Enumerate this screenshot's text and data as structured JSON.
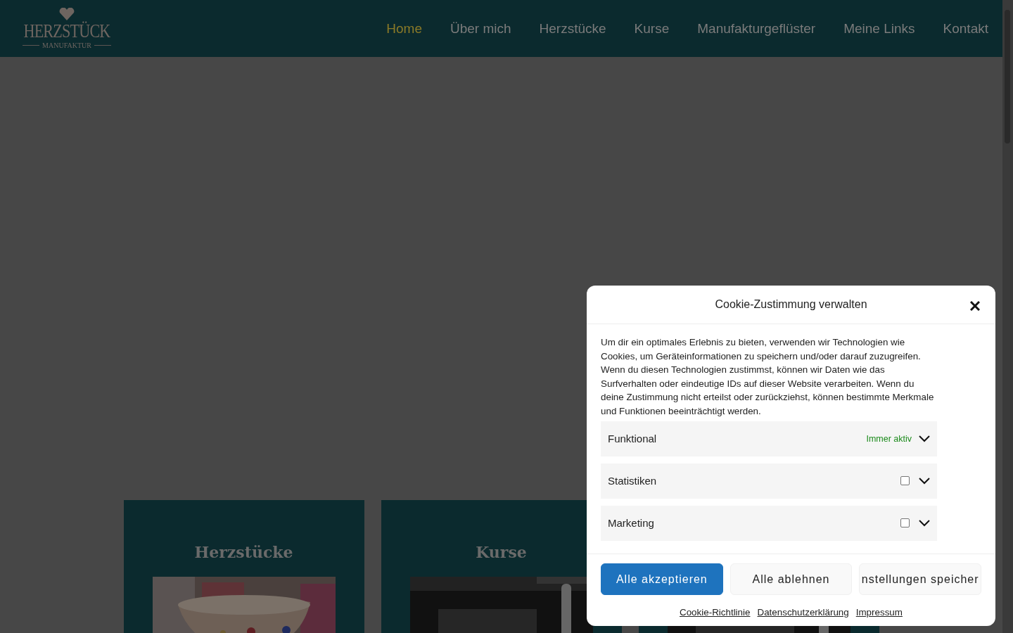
{
  "logo": {
    "title": "HERZSTÜCK",
    "subtitle": "MANUFAKTUR"
  },
  "nav": [
    {
      "label": "Home",
      "selected": true
    },
    {
      "label": "Über mich",
      "selected": false
    },
    {
      "label": "Herzstücke",
      "selected": false
    },
    {
      "label": "Kurse",
      "selected": false
    },
    {
      "label": "Manufakturgeflüster",
      "selected": false
    },
    {
      "label": "Meine Links",
      "selected": false
    },
    {
      "label": "Kontakt",
      "selected": false
    }
  ],
  "cards": [
    {
      "title": "Herzstücke",
      "kind": "bowl"
    },
    {
      "title": "Kurse",
      "kind": "dark"
    },
    {
      "kind": "dark"
    }
  ],
  "cookie_dialog": {
    "title": "Cookie-Zustimmung verwalten",
    "text": "Um dir ein optimales Erlebnis zu bieten, verwenden wir Technologien wie Cookies, um Geräteinformationen zu speichern und/oder darauf zuzugreifen. Wenn du diesen Technologien zustimmst, können wir Daten wie das Surfverhalten oder eindeutige IDs auf dieser Website verarbeiten. Wenn du deine Zustimmung nicht erteilst oder zurückziehst, können bestimmte Merkmale und Funktionen beeinträchtigt werden.",
    "categories": [
      {
        "label": "Funktional",
        "kind": "always",
        "status": "Immer aktiv",
        "expanded": false
      },
      {
        "label": "Statistiken",
        "kind": "checkbox",
        "checked": false,
        "expanded": false
      },
      {
        "label": "Marketing",
        "kind": "checkbox",
        "checked": false,
        "expanded": false
      }
    ],
    "buttons": [
      {
        "label": "Alle akzeptieren",
        "kind": "primary"
      },
      {
        "label": "Alle ablehnen",
        "kind": "secondary"
      },
      {
        "label": "nstellungen speicher",
        "kind": "secondary"
      }
    ],
    "links": [
      "Cookie-Richtlinie",
      "Datenschutzerklärung",
      "Impressum"
    ]
  }
}
